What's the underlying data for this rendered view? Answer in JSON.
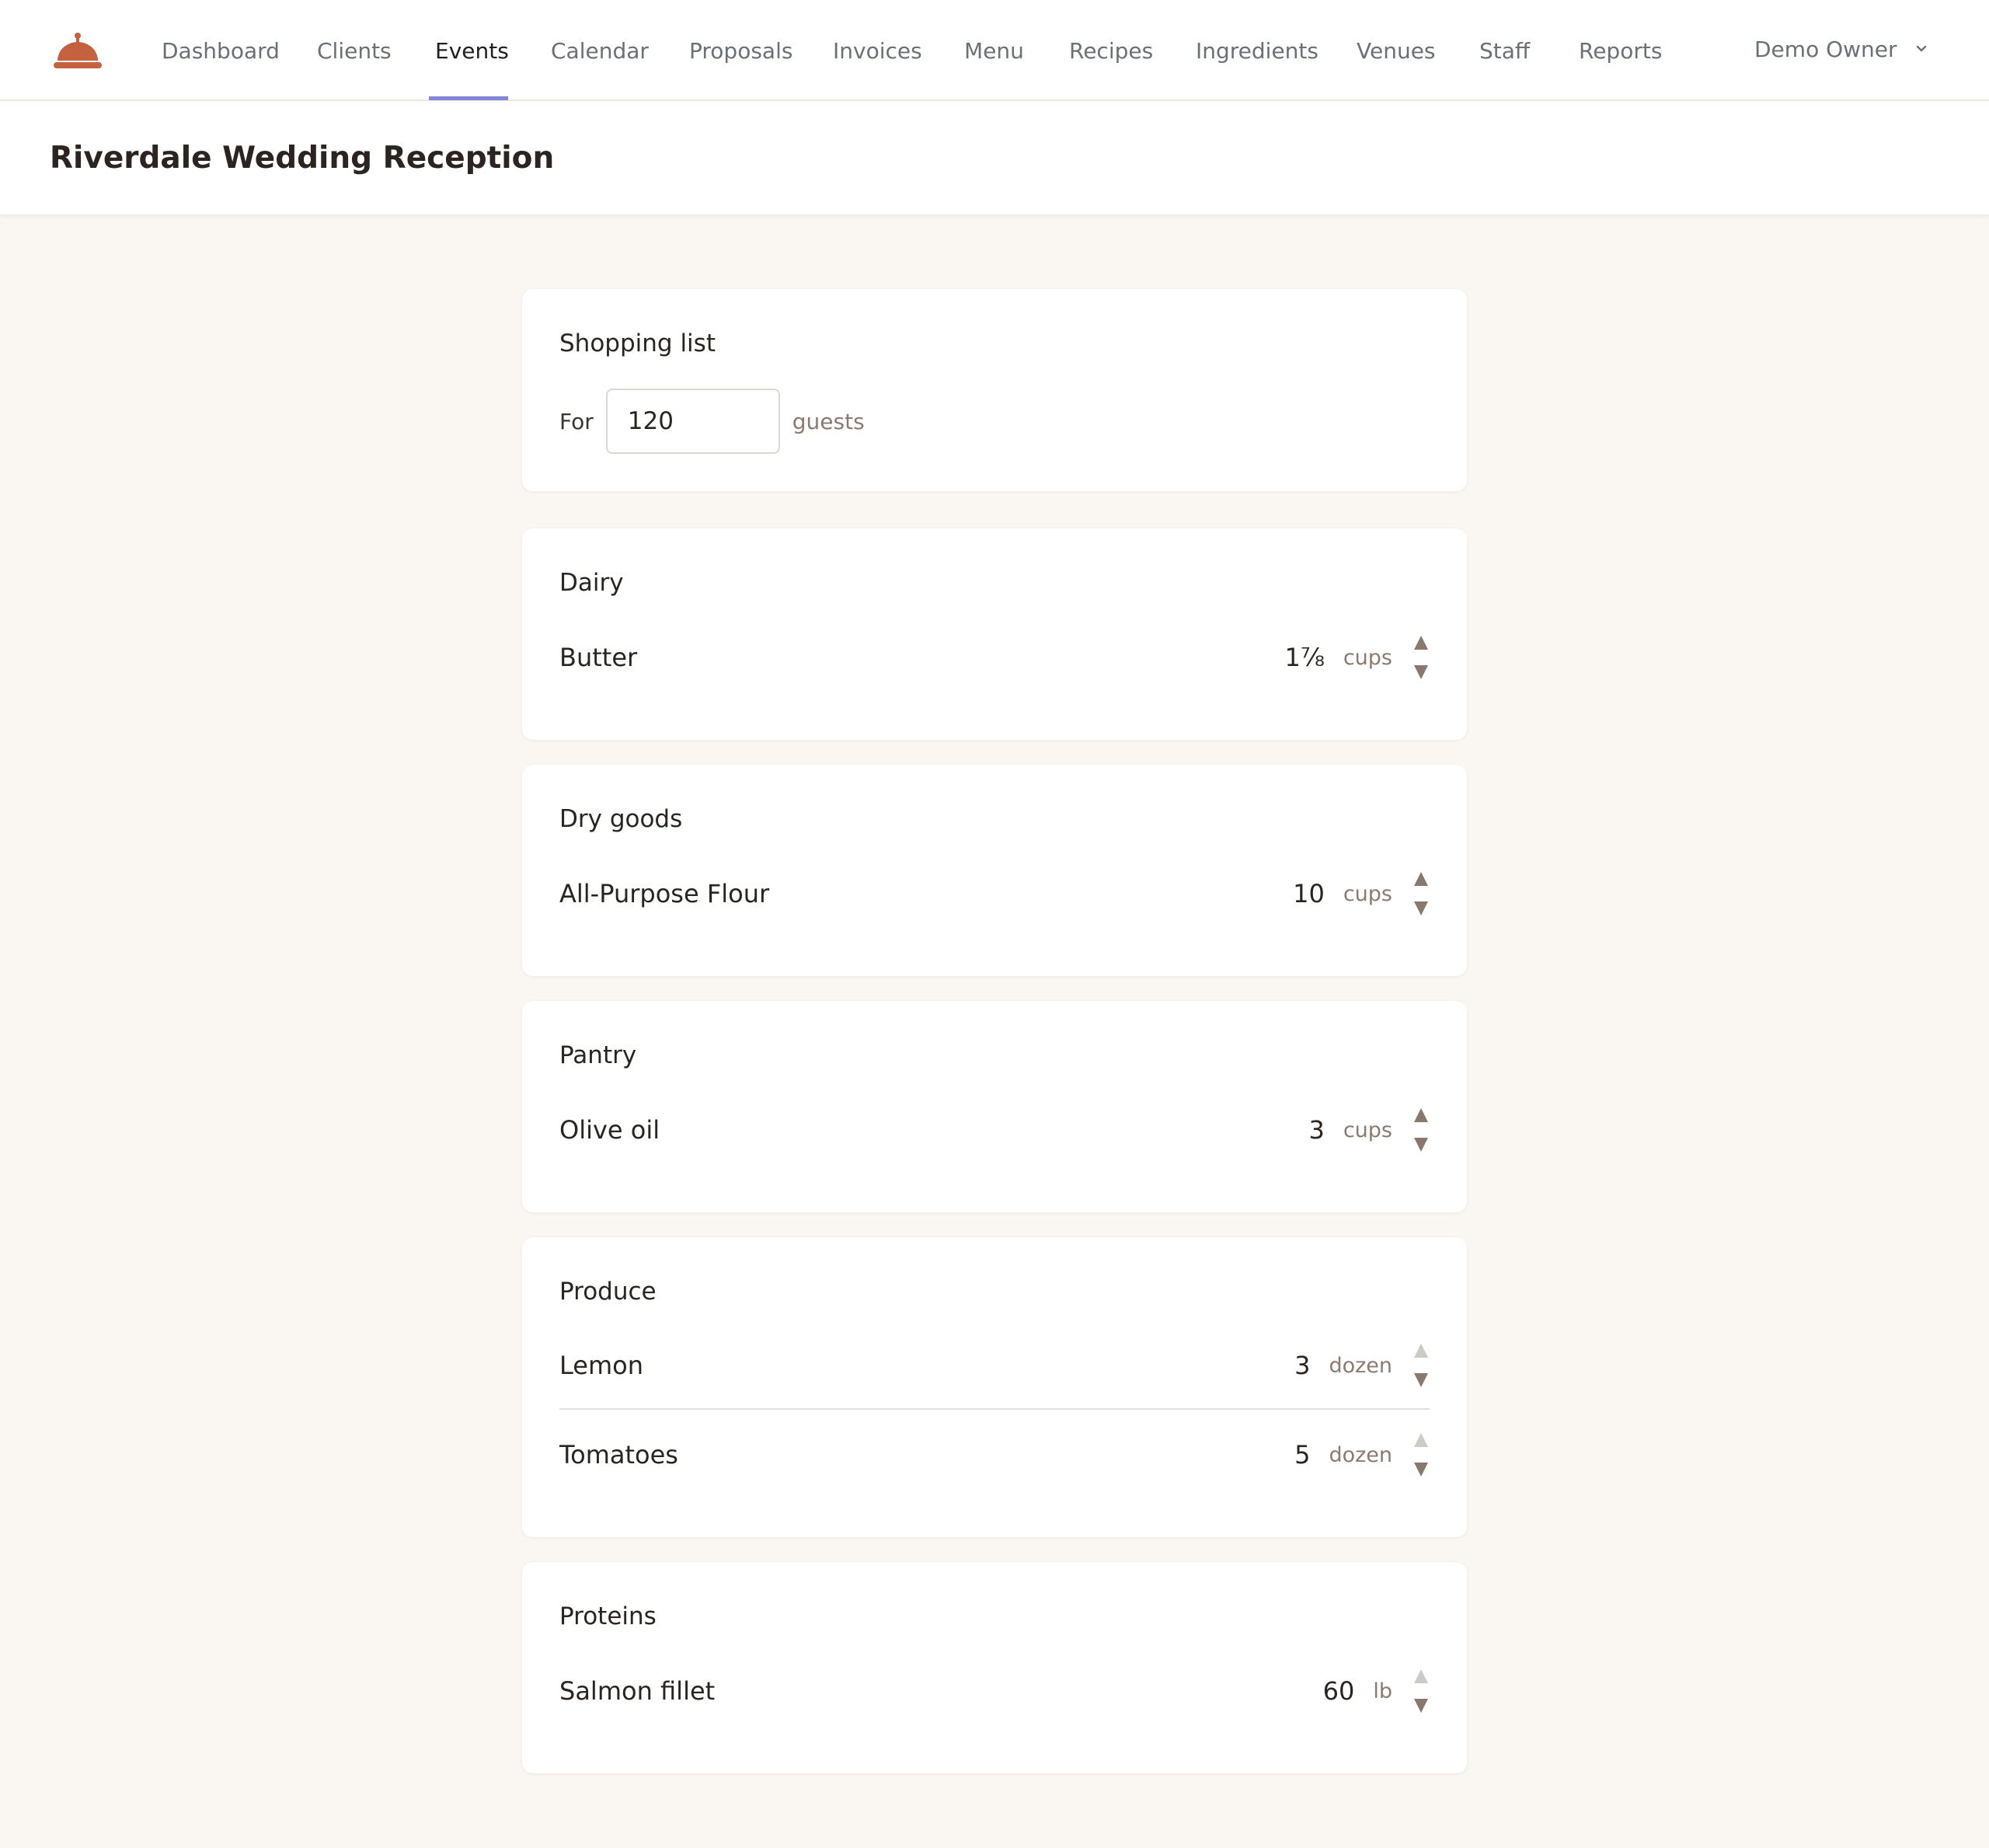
{
  "nav": {
    "items": [
      "Dashboard",
      "Clients",
      "Events",
      "Calendar",
      "Proposals",
      "Invoices",
      "Menu",
      "Recipes",
      "Ingredients",
      "Venues",
      "Staff",
      "Reports"
    ],
    "active": "Events",
    "user": "Demo Owner"
  },
  "page": {
    "title": "Riverdale Wedding Reception"
  },
  "shopping": {
    "title": "Shopping list",
    "for_label": "For",
    "guests_value": "120",
    "guests_label": "guests"
  },
  "categories": [
    {
      "name": "Dairy",
      "items": [
        {
          "name": "Butter",
          "qty": "1⅞",
          "unit": "cups",
          "up_enabled": true
        }
      ]
    },
    {
      "name": "Dry goods",
      "items": [
        {
          "name": "All-Purpose Flour",
          "qty": "10",
          "unit": "cups",
          "up_enabled": true
        }
      ]
    },
    {
      "name": "Pantry",
      "items": [
        {
          "name": "Olive oil",
          "qty": "3",
          "unit": "cups",
          "up_enabled": true
        }
      ]
    },
    {
      "name": "Produce",
      "items": [
        {
          "name": "Lemon",
          "qty": "3",
          "unit": "dozen",
          "up_enabled": false
        },
        {
          "name": "Tomatoes",
          "qty": "5",
          "unit": "dozen",
          "up_enabled": false
        }
      ]
    },
    {
      "name": "Proteins",
      "items": [
        {
          "name": "Salmon fillet",
          "qty": "60",
          "unit": "lb",
          "up_enabled": false
        }
      ]
    }
  ],
  "colors": {
    "brand": "#c4623f",
    "active_underline": "#8187d6",
    "arrow_enabled": "#8a786e",
    "arrow_disabled": "#cfcac6",
    "background": "#faf6f2"
  },
  "icons": {
    "logo": "cloche-icon",
    "user_menu": "chevron-down-icon",
    "step_up": "arrow-up-icon",
    "step_down": "arrow-down-icon"
  }
}
